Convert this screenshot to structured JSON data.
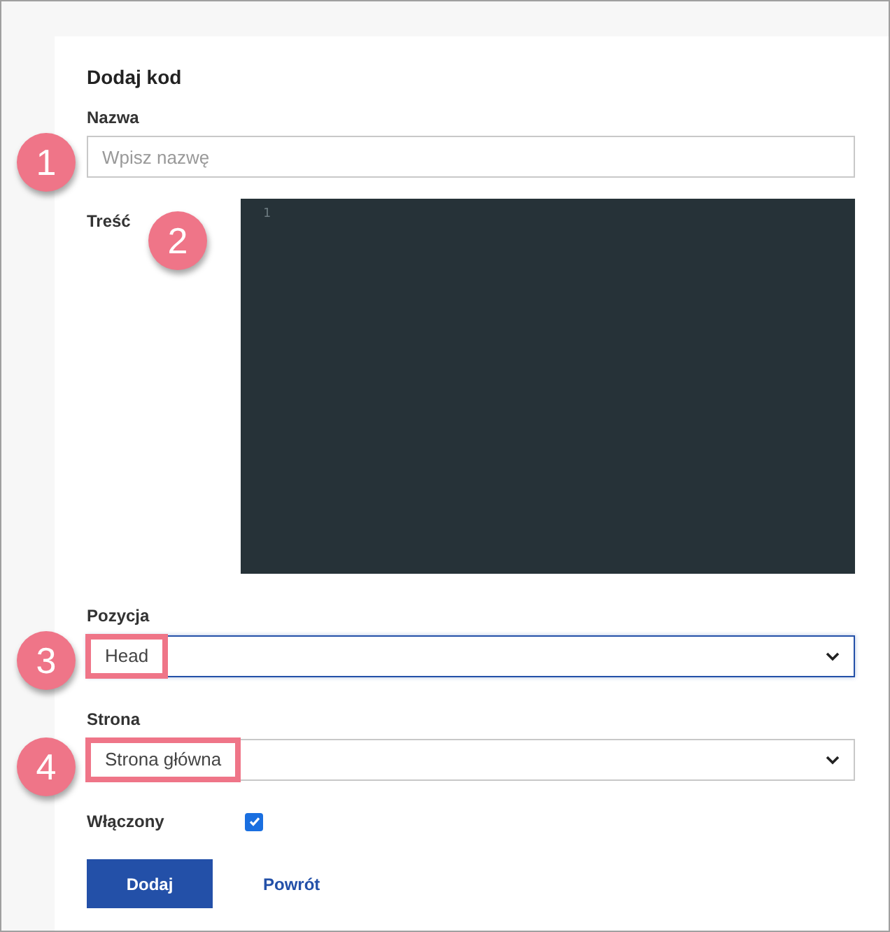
{
  "form": {
    "title": "Dodaj kod",
    "name_field": {
      "label": "Nazwa",
      "placeholder": "Wpisz nazwę",
      "callout": "1"
    },
    "content_field": {
      "label": "Treść",
      "line_numbers": [
        "1"
      ],
      "callout": "2"
    },
    "selects": [
      {
        "label": "Pozycja",
        "value": "Head",
        "focused": true,
        "highlighted": true,
        "callout": "3"
      },
      {
        "label": "Strona",
        "value": "Strona główna",
        "focused": false,
        "highlighted": true,
        "callout": "4"
      }
    ],
    "enabled": {
      "label": "Włączony",
      "checked": true
    },
    "submit": "Dodaj",
    "back_link": "Powrót"
  }
}
